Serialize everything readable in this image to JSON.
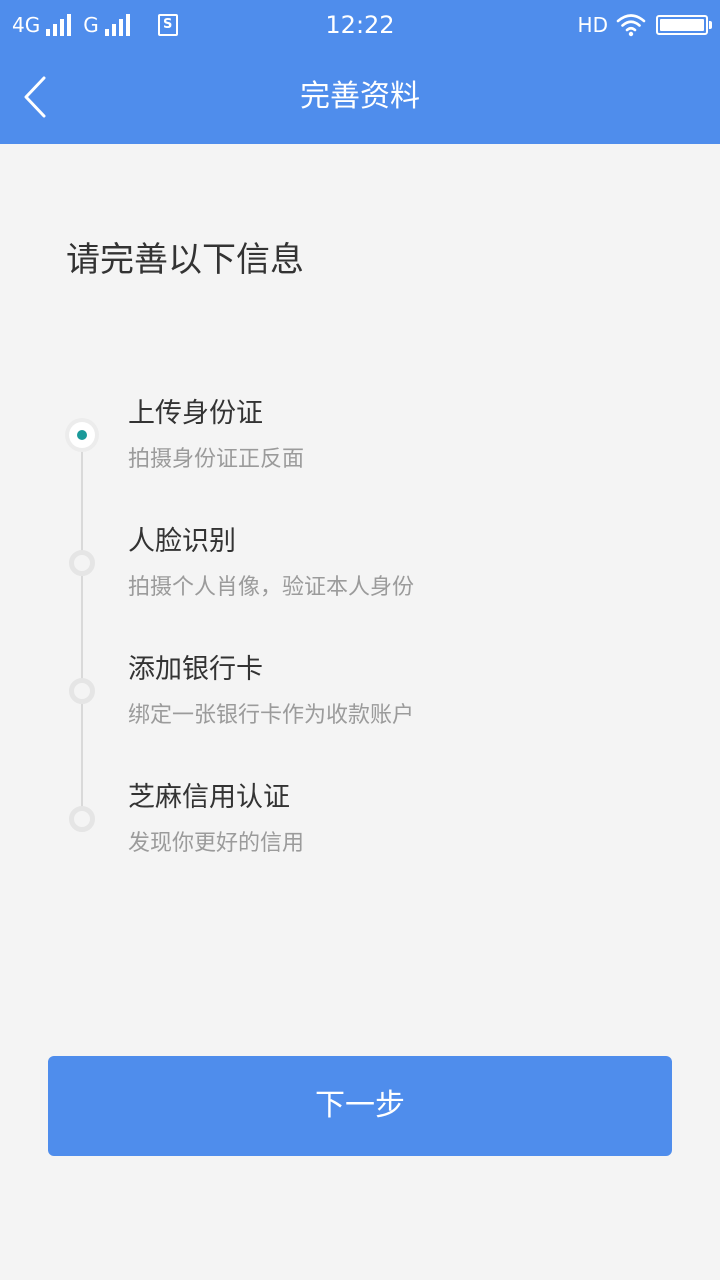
{
  "status_bar": {
    "network1": "4G",
    "network2": "G",
    "sim_badge": "S",
    "time": "12:22",
    "hd_label": "HD",
    "icons": [
      "signal-icon",
      "sim-icon",
      "wifi-icon",
      "battery-icon"
    ]
  },
  "nav": {
    "back_icon": "chevron-left-icon",
    "title": "完善资料"
  },
  "main": {
    "heading": "请完善以下信息",
    "steps": [
      {
        "title": "上传身份证",
        "desc": "拍摄身份证正反面",
        "active": true
      },
      {
        "title": "人脸识别",
        "desc": "拍摄个人肖像，验证本人身份",
        "active": false
      },
      {
        "title": "添加银行卡",
        "desc": "绑定一张银行卡作为收款账户",
        "active": false
      },
      {
        "title": "芝麻信用认证",
        "desc": "发现你更好的信用",
        "active": false
      }
    ],
    "next_label": "下一步"
  },
  "colors": {
    "primary": "#4f8dec",
    "background": "#f4f4f4",
    "active_dot": "#1a9a9a",
    "title_text": "#333333",
    "desc_text": "#9b9b9b"
  }
}
